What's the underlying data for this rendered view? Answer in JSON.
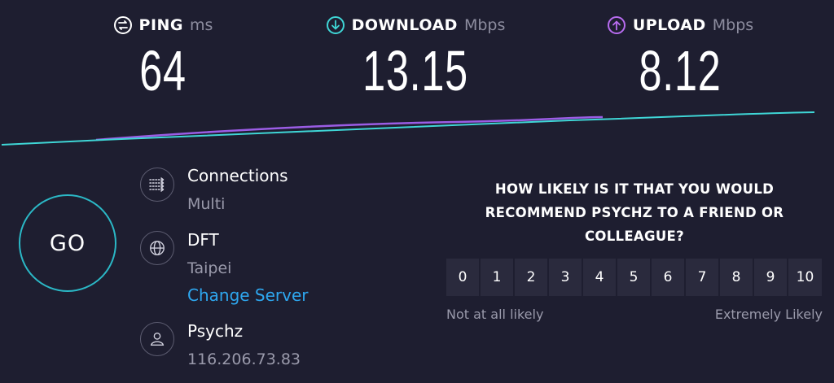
{
  "metrics": {
    "ping": {
      "label": "PING",
      "unit": "ms",
      "value": "64"
    },
    "download": {
      "label": "DOWNLOAD",
      "unit": "Mbps",
      "value": "13.15"
    },
    "upload": {
      "label": "UPLOAD",
      "unit": "Mbps",
      "value": "8.12"
    }
  },
  "colors": {
    "background": "#1e1e30",
    "download_line": "#3fd6d6",
    "upload_line": "#9b5de5",
    "go_ring": "#2bb8c6",
    "link": "#2ea7ef"
  },
  "go_button": {
    "label": "GO"
  },
  "connections": {
    "title": "Connections",
    "value": "Multi",
    "icon": "connections-icon"
  },
  "server": {
    "title": "DFT",
    "location": "Taipei",
    "change_label": "Change Server",
    "icon": "globe-icon"
  },
  "provider": {
    "title": "Psychz",
    "ip": "116.206.73.83",
    "icon": "user-icon"
  },
  "survey": {
    "question": "HOW LIKELY IS IT THAT YOU WOULD RECOMMEND PSYCHZ TO A FRIEND OR COLLEAGUE?",
    "options": [
      "0",
      "1",
      "2",
      "3",
      "4",
      "5",
      "6",
      "7",
      "8",
      "9",
      "10"
    ],
    "low_label": "Not at all likely",
    "high_label": "Extremely Likely"
  }
}
